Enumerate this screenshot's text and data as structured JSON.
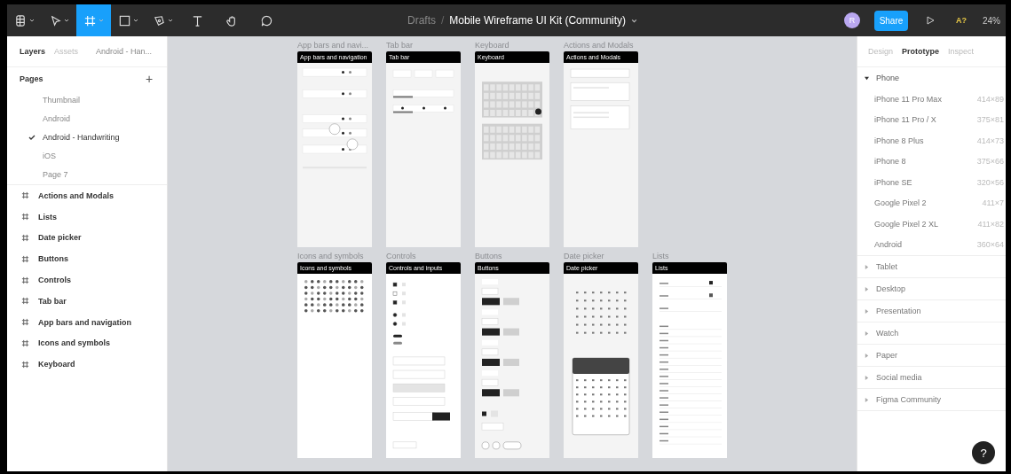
{
  "toolbar": {
    "tools": [
      {
        "kind": "main-menu",
        "dropdown": true,
        "selected": false
      },
      {
        "kind": "move",
        "dropdown": true,
        "selected": false
      },
      {
        "kind": "frame",
        "dropdown": true,
        "selected": true
      },
      {
        "kind": "shape",
        "dropdown": true,
        "selected": false
      },
      {
        "kind": "pen",
        "dropdown": true,
        "selected": false
      },
      {
        "kind": "text",
        "dropdown": false,
        "selected": false
      },
      {
        "kind": "hand",
        "dropdown": false,
        "selected": false
      },
      {
        "kind": "comment",
        "dropdown": false,
        "selected": false
      }
    ],
    "breadcrumb": {
      "folder": "Drafts",
      "separator": "/",
      "file": "Mobile Wireframe UI Kit (Community)"
    },
    "avatar": "R",
    "share": "Share",
    "font_warning": "A?",
    "zoom": "24%"
  },
  "left_panel": {
    "tabs": [
      {
        "label": "Layers",
        "selected": true
      },
      {
        "label": "Assets",
        "selected": false
      }
    ],
    "page_selector": "Android - Han...",
    "pages_heading": "Pages",
    "add": "+",
    "pages": [
      {
        "label": "Thumbnail",
        "selected": false
      },
      {
        "label": "Android",
        "selected": false
      },
      {
        "label": "Android - Handwriting",
        "selected": true
      },
      {
        "label": "iOS",
        "selected": false
      },
      {
        "label": "Page 7",
        "selected": false
      }
    ],
    "layers": [
      "Actions and Modals",
      "Lists",
      "Date picker",
      "Buttons",
      "Controls",
      "Tab bar",
      "App bars and navigation",
      "Icons and symbols",
      "Keyboard"
    ]
  },
  "canvas": {
    "rows": [
      [
        {
          "label": "App bars and navi...",
          "header": "App bars and navigation",
          "kind": "appbars"
        },
        {
          "label": "Tab bar",
          "header": "Tab bar",
          "kind": "tabbar"
        },
        {
          "label": "Keyboard",
          "header": "Keyboard",
          "kind": "keyboard"
        },
        {
          "label": "Actions and Modals",
          "header": "Actions and Modals",
          "kind": "modals"
        }
      ],
      [
        {
          "label": "Icons and symbols",
          "header": "Icons and symbols",
          "kind": "icons"
        },
        {
          "label": "Controls",
          "header": "Controls and inputs",
          "kind": "controls"
        },
        {
          "label": "Buttons",
          "header": "Buttons",
          "kind": "buttons"
        },
        {
          "label": "Date picker",
          "header": "Date picker",
          "kind": "datepicker"
        },
        {
          "label": "Lists",
          "header": "Lists",
          "kind": "lists"
        }
      ]
    ]
  },
  "right_panel": {
    "tabs": [
      {
        "label": "Design",
        "selected": false
      },
      {
        "label": "Prototype",
        "selected": true
      },
      {
        "label": "Inspect",
        "selected": false
      }
    ],
    "sections": [
      {
        "label": "Phone",
        "expanded": true,
        "devices": [
          {
            "name": "iPhone 11 Pro Max",
            "size": "414×89"
          },
          {
            "name": "iPhone 11 Pro / X",
            "size": "375×81"
          },
          {
            "name": "iPhone 8 Plus",
            "size": "414×73"
          },
          {
            "name": "iPhone 8",
            "size": "375×66"
          },
          {
            "name": "iPhone SE",
            "size": "320×56"
          },
          {
            "name": "Google Pixel 2",
            "size": "411×7"
          },
          {
            "name": "Google Pixel 2 XL",
            "size": "411×82"
          },
          {
            "name": "Android",
            "size": "360×64"
          }
        ]
      },
      {
        "label": "Tablet",
        "expanded": false
      },
      {
        "label": "Desktop",
        "expanded": false
      },
      {
        "label": "Presentation",
        "expanded": false
      },
      {
        "label": "Watch",
        "expanded": false
      },
      {
        "label": "Paper",
        "expanded": false
      },
      {
        "label": "Social media",
        "expanded": false
      },
      {
        "label": "Figma Community",
        "expanded": false
      }
    ],
    "help": "?"
  }
}
